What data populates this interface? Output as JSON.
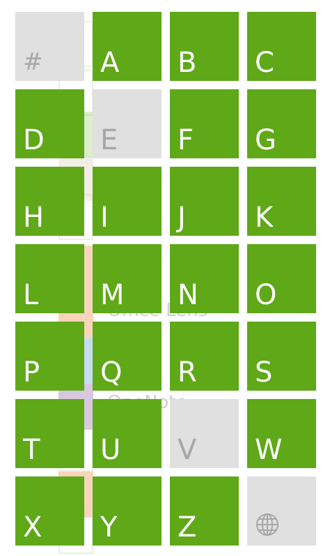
{
  "colors": {
    "active_tile": "#5fa818",
    "inactive_tile": "#e0e0e0",
    "active_text": "#ffffff",
    "inactive_text": "#a7a7a7"
  },
  "background_list": {
    "items": [
      {
        "label": "",
        "icon": "outline-square"
      },
      {
        "label": "",
        "icon": "green-outline-square"
      },
      {
        "label": "",
        "icon": "light-green-icon"
      },
      {
        "label": "",
        "icon": "pencil-icon"
      },
      {
        "label": "",
        "icon": "outline-square"
      },
      {
        "label": "",
        "icon": "orange-tile-icon"
      },
      {
        "label": "Office Lens",
        "icon": "office-lens-icon"
      },
      {
        "label": "",
        "icon": "blue-person-icon"
      },
      {
        "label": "OneNote",
        "icon": "onenote-icon"
      },
      {
        "label": "",
        "icon": "outline-square"
      },
      {
        "label": "",
        "icon": "orange-tile-icon"
      },
      {
        "label": "",
        "icon": "outline-square"
      }
    ]
  },
  "jump_list": {
    "tiles": [
      {
        "label": "#",
        "enabled": false
      },
      {
        "label": "A",
        "enabled": true
      },
      {
        "label": "B",
        "enabled": true
      },
      {
        "label": "C",
        "enabled": true
      },
      {
        "label": "D",
        "enabled": true
      },
      {
        "label": "E",
        "enabled": false
      },
      {
        "label": "F",
        "enabled": true
      },
      {
        "label": "G",
        "enabled": true
      },
      {
        "label": "H",
        "enabled": true
      },
      {
        "label": "I",
        "enabled": true
      },
      {
        "label": "J",
        "enabled": true
      },
      {
        "label": "K",
        "enabled": true
      },
      {
        "label": "L",
        "enabled": true
      },
      {
        "label": "M",
        "enabled": true
      },
      {
        "label": "N",
        "enabled": true
      },
      {
        "label": "O",
        "enabled": true
      },
      {
        "label": "P",
        "enabled": true
      },
      {
        "label": "Q",
        "enabled": true
      },
      {
        "label": "R",
        "enabled": true
      },
      {
        "label": "S",
        "enabled": true
      },
      {
        "label": "T",
        "enabled": true
      },
      {
        "label": "U",
        "enabled": true
      },
      {
        "label": "V",
        "enabled": false
      },
      {
        "label": "W",
        "enabled": true
      },
      {
        "label": "X",
        "enabled": true
      },
      {
        "label": "Y",
        "enabled": true
      },
      {
        "label": "Z",
        "enabled": true
      },
      {
        "label": "",
        "enabled": false,
        "icon": "globe-icon"
      }
    ]
  }
}
